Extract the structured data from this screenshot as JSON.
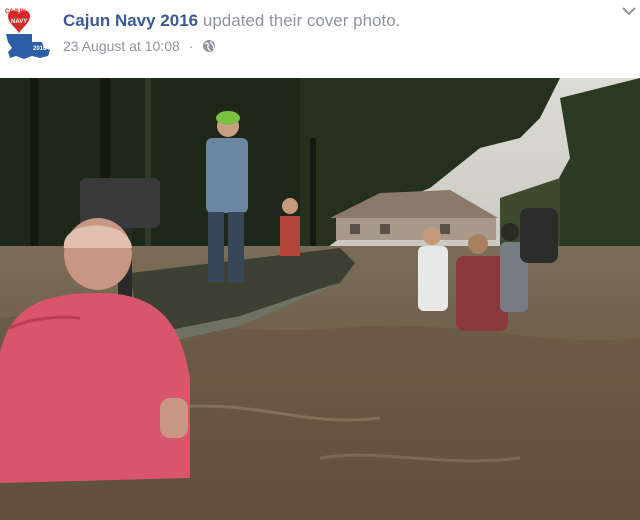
{
  "post": {
    "page_name": "Cajun Navy 2016",
    "action": "updated their cover photo.",
    "timestamp": "23 August at 10:08",
    "separator": "·",
    "privacy_icon": "globe-icon",
    "menu_icon": "chevron-down-icon"
  },
  "avatar": {
    "logo_text_top": "CAJUN",
    "logo_text_mid": "NAVY",
    "logo_text_year": "2016"
  },
  "colors": {
    "link": "#3b5998",
    "meta": "#90949c",
    "water": "#6b5b45"
  }
}
